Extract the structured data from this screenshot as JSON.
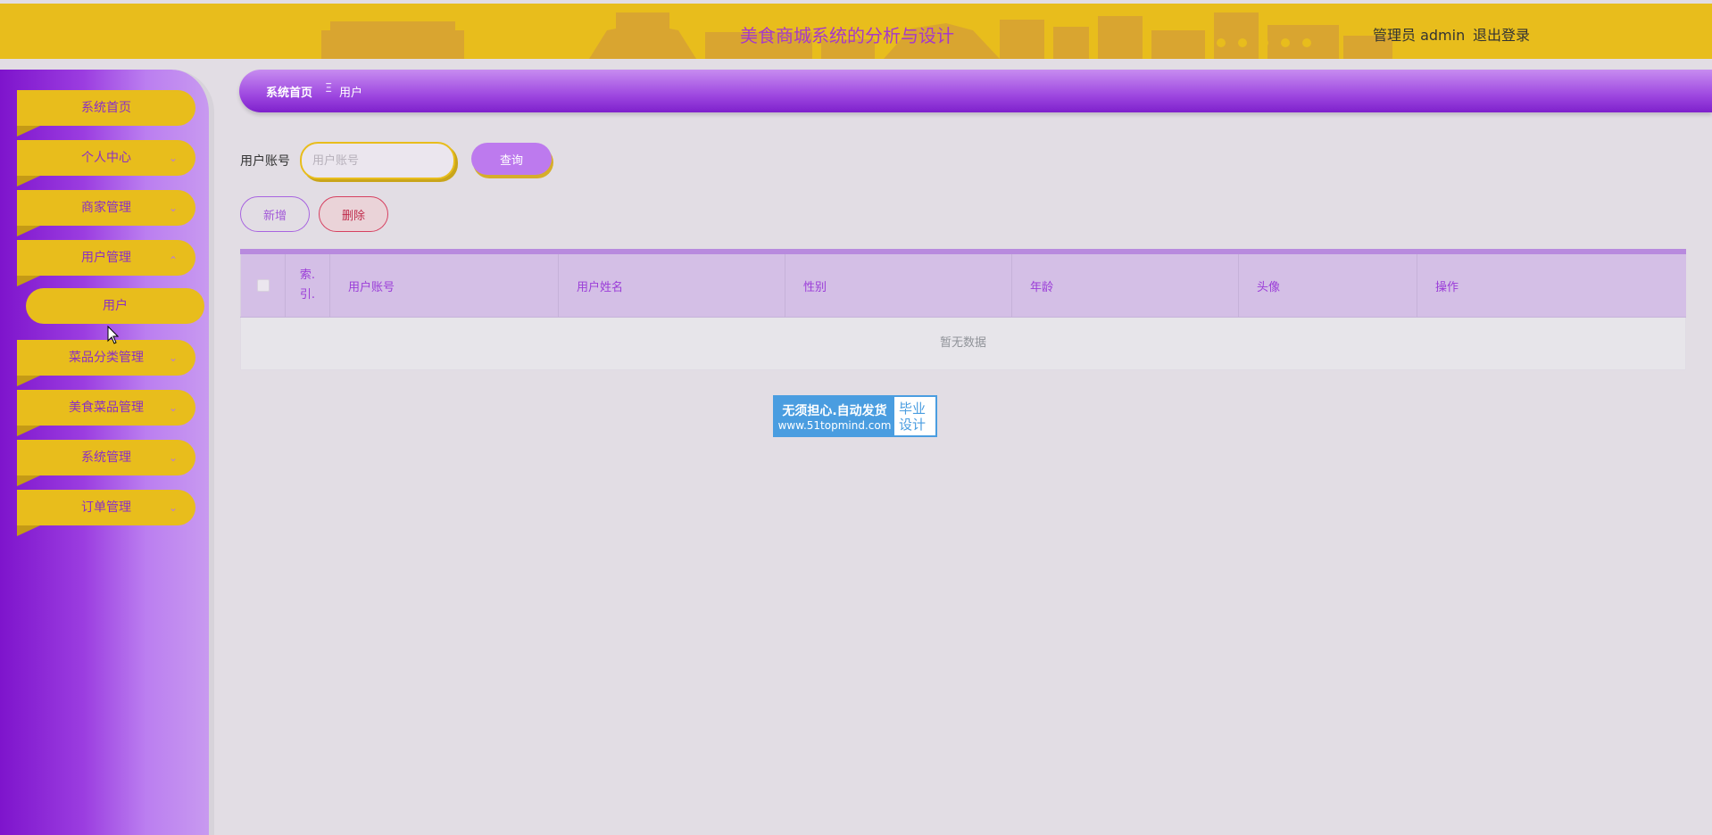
{
  "header": {
    "title": "美食商城系统的分析与设计",
    "user": "管理员 admin",
    "logout": "退出登录"
  },
  "sidebar": {
    "items": [
      {
        "label": "系统首页",
        "expandable": false
      },
      {
        "label": "个人中心",
        "expandable": true,
        "icon": "chevron-down-icon"
      },
      {
        "label": "商家管理",
        "expandable": true,
        "icon": "chevron-down-icon"
      },
      {
        "label": "用户管理",
        "expandable": true,
        "icon": "chevron-up-icon",
        "expanded": true,
        "children": [
          {
            "label": "用户"
          }
        ]
      },
      {
        "label": "菜品分类管理",
        "expandable": true,
        "icon": "chevron-down-icon"
      },
      {
        "label": "美食菜品管理",
        "expandable": true,
        "icon": "chevron-down-icon"
      },
      {
        "label": "系统管理",
        "expandable": true,
        "icon": "chevron-down-icon"
      },
      {
        "label": "订单管理",
        "expandable": true,
        "icon": "chevron-down-icon"
      }
    ]
  },
  "breadcrumb": {
    "home": "系统首页",
    "separator": "Ξ",
    "current": "用户"
  },
  "search": {
    "label": "用户账号",
    "placeholder": "用户账号",
    "value": "",
    "button": "查询"
  },
  "actions": {
    "add": "新增",
    "delete": "删除"
  },
  "table": {
    "columns": [
      "索引",
      "用户账号",
      "用户姓名",
      "性别",
      "年龄",
      "头像",
      "操作"
    ],
    "index_line1": "索.",
    "index_line2": "引.",
    "empty_text": "暂无数据"
  },
  "badge": {
    "line1": "无须担心.自动发货",
    "line2": "www.51topmind.com",
    "right1": "毕业",
    "right2": "设计"
  },
  "colors": {
    "header_bg": "#e8bd1c",
    "title": "#a63ac8",
    "sidebar_gradient": [
      "#7e14cc",
      "#c89af0"
    ],
    "menu_item_bg": "#e8bd1c",
    "accent": "#bd7aee"
  }
}
